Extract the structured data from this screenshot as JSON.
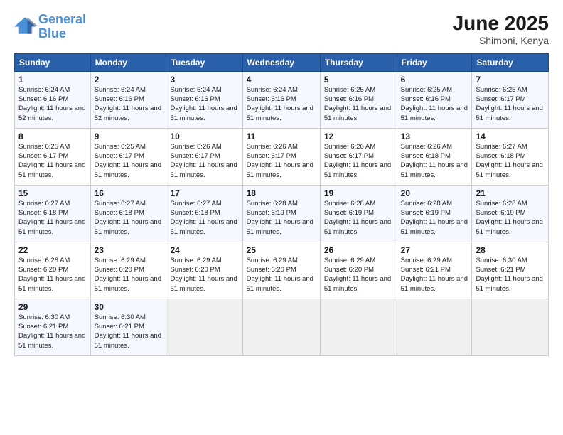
{
  "logo": {
    "line1": "General",
    "line2": "Blue"
  },
  "title": "June 2025",
  "location": "Shimoni, Kenya",
  "days_header": [
    "Sunday",
    "Monday",
    "Tuesday",
    "Wednesday",
    "Thursday",
    "Friday",
    "Saturday"
  ],
  "weeks": [
    [
      {
        "day": "1",
        "sunrise": "Sunrise: 6:24 AM",
        "sunset": "Sunset: 6:16 PM",
        "daylight": "Daylight: 11 hours and 52 minutes."
      },
      {
        "day": "2",
        "sunrise": "Sunrise: 6:24 AM",
        "sunset": "Sunset: 6:16 PM",
        "daylight": "Daylight: 11 hours and 52 minutes."
      },
      {
        "day": "3",
        "sunrise": "Sunrise: 6:24 AM",
        "sunset": "Sunset: 6:16 PM",
        "daylight": "Daylight: 11 hours and 51 minutes."
      },
      {
        "day": "4",
        "sunrise": "Sunrise: 6:24 AM",
        "sunset": "Sunset: 6:16 PM",
        "daylight": "Daylight: 11 hours and 51 minutes."
      },
      {
        "day": "5",
        "sunrise": "Sunrise: 6:25 AM",
        "sunset": "Sunset: 6:16 PM",
        "daylight": "Daylight: 11 hours and 51 minutes."
      },
      {
        "day": "6",
        "sunrise": "Sunrise: 6:25 AM",
        "sunset": "Sunset: 6:16 PM",
        "daylight": "Daylight: 11 hours and 51 minutes."
      },
      {
        "day": "7",
        "sunrise": "Sunrise: 6:25 AM",
        "sunset": "Sunset: 6:17 PM",
        "daylight": "Daylight: 11 hours and 51 minutes."
      }
    ],
    [
      {
        "day": "8",
        "sunrise": "Sunrise: 6:25 AM",
        "sunset": "Sunset: 6:17 PM",
        "daylight": "Daylight: 11 hours and 51 minutes."
      },
      {
        "day": "9",
        "sunrise": "Sunrise: 6:25 AM",
        "sunset": "Sunset: 6:17 PM",
        "daylight": "Daylight: 11 hours and 51 minutes."
      },
      {
        "day": "10",
        "sunrise": "Sunrise: 6:26 AM",
        "sunset": "Sunset: 6:17 PM",
        "daylight": "Daylight: 11 hours and 51 minutes."
      },
      {
        "day": "11",
        "sunrise": "Sunrise: 6:26 AM",
        "sunset": "Sunset: 6:17 PM",
        "daylight": "Daylight: 11 hours and 51 minutes."
      },
      {
        "day": "12",
        "sunrise": "Sunrise: 6:26 AM",
        "sunset": "Sunset: 6:17 PM",
        "daylight": "Daylight: 11 hours and 51 minutes."
      },
      {
        "day": "13",
        "sunrise": "Sunrise: 6:26 AM",
        "sunset": "Sunset: 6:18 PM",
        "daylight": "Daylight: 11 hours and 51 minutes."
      },
      {
        "day": "14",
        "sunrise": "Sunrise: 6:27 AM",
        "sunset": "Sunset: 6:18 PM",
        "daylight": "Daylight: 11 hours and 51 minutes."
      }
    ],
    [
      {
        "day": "15",
        "sunrise": "Sunrise: 6:27 AM",
        "sunset": "Sunset: 6:18 PM",
        "daylight": "Daylight: 11 hours and 51 minutes."
      },
      {
        "day": "16",
        "sunrise": "Sunrise: 6:27 AM",
        "sunset": "Sunset: 6:18 PM",
        "daylight": "Daylight: 11 hours and 51 minutes."
      },
      {
        "day": "17",
        "sunrise": "Sunrise: 6:27 AM",
        "sunset": "Sunset: 6:18 PM",
        "daylight": "Daylight: 11 hours and 51 minutes."
      },
      {
        "day": "18",
        "sunrise": "Sunrise: 6:28 AM",
        "sunset": "Sunset: 6:19 PM",
        "daylight": "Daylight: 11 hours and 51 minutes."
      },
      {
        "day": "19",
        "sunrise": "Sunrise: 6:28 AM",
        "sunset": "Sunset: 6:19 PM",
        "daylight": "Daylight: 11 hours and 51 minutes."
      },
      {
        "day": "20",
        "sunrise": "Sunrise: 6:28 AM",
        "sunset": "Sunset: 6:19 PM",
        "daylight": "Daylight: 11 hours and 51 minutes."
      },
      {
        "day": "21",
        "sunrise": "Sunrise: 6:28 AM",
        "sunset": "Sunset: 6:19 PM",
        "daylight": "Daylight: 11 hours and 51 minutes."
      }
    ],
    [
      {
        "day": "22",
        "sunrise": "Sunrise: 6:28 AM",
        "sunset": "Sunset: 6:20 PM",
        "daylight": "Daylight: 11 hours and 51 minutes."
      },
      {
        "day": "23",
        "sunrise": "Sunrise: 6:29 AM",
        "sunset": "Sunset: 6:20 PM",
        "daylight": "Daylight: 11 hours and 51 minutes."
      },
      {
        "day": "24",
        "sunrise": "Sunrise: 6:29 AM",
        "sunset": "Sunset: 6:20 PM",
        "daylight": "Daylight: 11 hours and 51 minutes."
      },
      {
        "day": "25",
        "sunrise": "Sunrise: 6:29 AM",
        "sunset": "Sunset: 6:20 PM",
        "daylight": "Daylight: 11 hours and 51 minutes."
      },
      {
        "day": "26",
        "sunrise": "Sunrise: 6:29 AM",
        "sunset": "Sunset: 6:20 PM",
        "daylight": "Daylight: 11 hours and 51 minutes."
      },
      {
        "day": "27",
        "sunrise": "Sunrise: 6:29 AM",
        "sunset": "Sunset: 6:21 PM",
        "daylight": "Daylight: 11 hours and 51 minutes."
      },
      {
        "day": "28",
        "sunrise": "Sunrise: 6:30 AM",
        "sunset": "Sunset: 6:21 PM",
        "daylight": "Daylight: 11 hours and 51 minutes."
      }
    ],
    [
      {
        "day": "29",
        "sunrise": "Sunrise: 6:30 AM",
        "sunset": "Sunset: 6:21 PM",
        "daylight": "Daylight: 11 hours and 51 minutes."
      },
      {
        "day": "30",
        "sunrise": "Sunrise: 6:30 AM",
        "sunset": "Sunset: 6:21 PM",
        "daylight": "Daylight: 11 hours and 51 minutes."
      },
      null,
      null,
      null,
      null,
      null
    ]
  ]
}
